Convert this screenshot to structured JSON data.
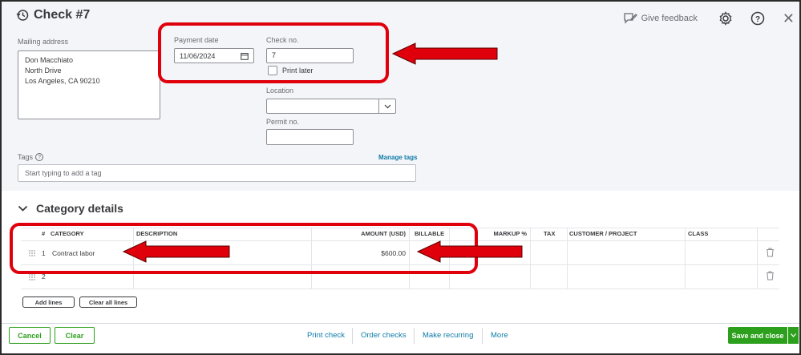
{
  "header": {
    "title": "Check #7",
    "give_feedback": "Give feedback",
    "icons": [
      "history-icon",
      "feedback-icon",
      "gear-icon",
      "help-icon",
      "close-icon"
    ]
  },
  "form": {
    "mailing_address_label": "Mailing address",
    "mailing_address": "Don Macchiato\nNorth Drive\nLos Angeles, CA  90210",
    "payment_date_label": "Payment date",
    "payment_date": "11/06/2024",
    "check_no_label": "Check no.",
    "check_no": "7",
    "print_later_label": "Print later",
    "print_later_checked": false,
    "location_label": "Location",
    "location_value": "",
    "permit_label": "Permit no.",
    "permit_value": "",
    "tags_label": "Tags",
    "manage_tags": "Manage tags",
    "tags_placeholder": "Start typing to add a tag"
  },
  "category": {
    "heading": "Category details",
    "columns": {
      "num": "#",
      "category": "CATEGORY",
      "description": "DESCRIPTION",
      "amount": "AMOUNT (USD)",
      "billable": "BILLABLE",
      "markup": "MARKUP %",
      "tax": "TAX",
      "customer": "CUSTOMER / PROJECT",
      "class": "CLASS"
    },
    "rows": [
      {
        "num": "1",
        "category": "Contract labor",
        "description": "",
        "amount": "$600.00"
      },
      {
        "num": "2",
        "category": "",
        "description": "",
        "amount": ""
      }
    ],
    "add_lines": "Add lines",
    "clear_all_lines": "Clear all lines"
  },
  "footer": {
    "cancel": "Cancel",
    "clear": "Clear",
    "print_check": "Print check",
    "order_checks": "Order checks",
    "make_recurring": "Make recurring",
    "more": "More",
    "save_and_close": "Save and close"
  },
  "colors": {
    "accent_green": "#2ca01c",
    "link_blue": "#0d7ba8",
    "annotation_red": "#e0000b"
  }
}
